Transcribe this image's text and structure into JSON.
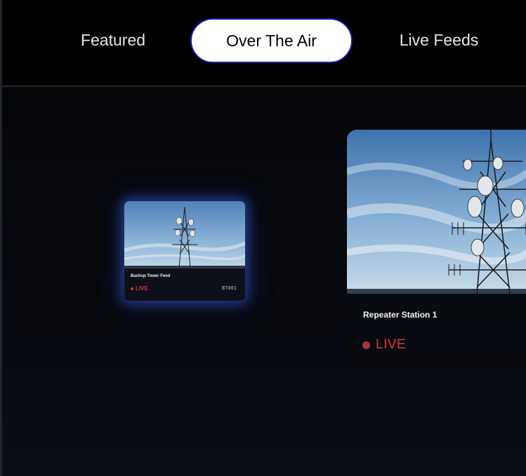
{
  "tabs": [
    {
      "label": "Featured",
      "active": false
    },
    {
      "label": "Over The Air",
      "active": true
    },
    {
      "label": "Live Feeds",
      "active": false
    }
  ],
  "cards": [
    {
      "title": "Backup Tower Feed",
      "status": "LIVE",
      "code": "BT001",
      "thumbnail_icon": "antenna-tower-image",
      "focused": true
    },
    {
      "title": "Repeater Station 1",
      "status": "LIVE",
      "thumbnail_icon": "antenna-tower-image",
      "focused": false
    }
  ],
  "colors": {
    "background": "#000000",
    "active_tab_bg": "#ffffff",
    "active_tab_border": "#1d1fa8",
    "live_red": "#cf3b3f",
    "focus_glow": "#3a60dc"
  }
}
